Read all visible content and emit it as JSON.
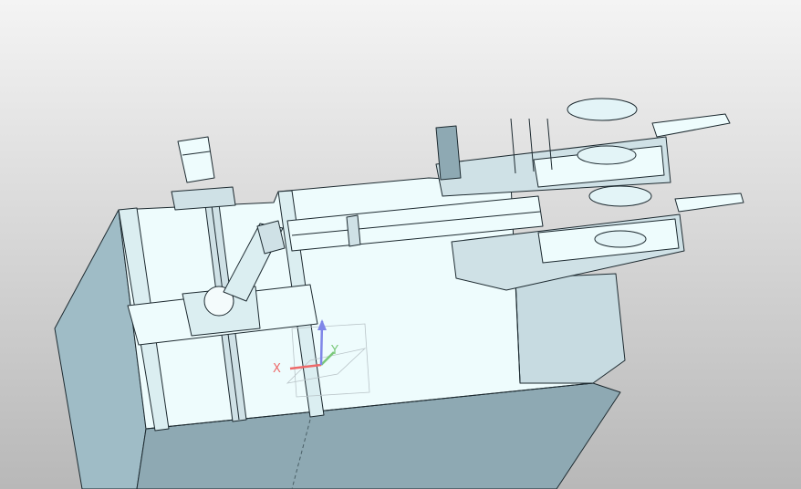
{
  "viewport": {
    "kind": "3d-cad-model-view",
    "background_top": "#f4f4f4",
    "background_bottom": "#b8b8b8",
    "model_face_light": "#eefcfd",
    "model_face_mid": "#cfe1e6",
    "model_face_dark": "#8ea9b3",
    "edge_color": "#1d2a30"
  },
  "triad": {
    "x_label": "X",
    "y_label": "Y",
    "x_color": "#ee6a6a",
    "y_color": "#7ac87a",
    "z_color": "#7f86e8"
  }
}
